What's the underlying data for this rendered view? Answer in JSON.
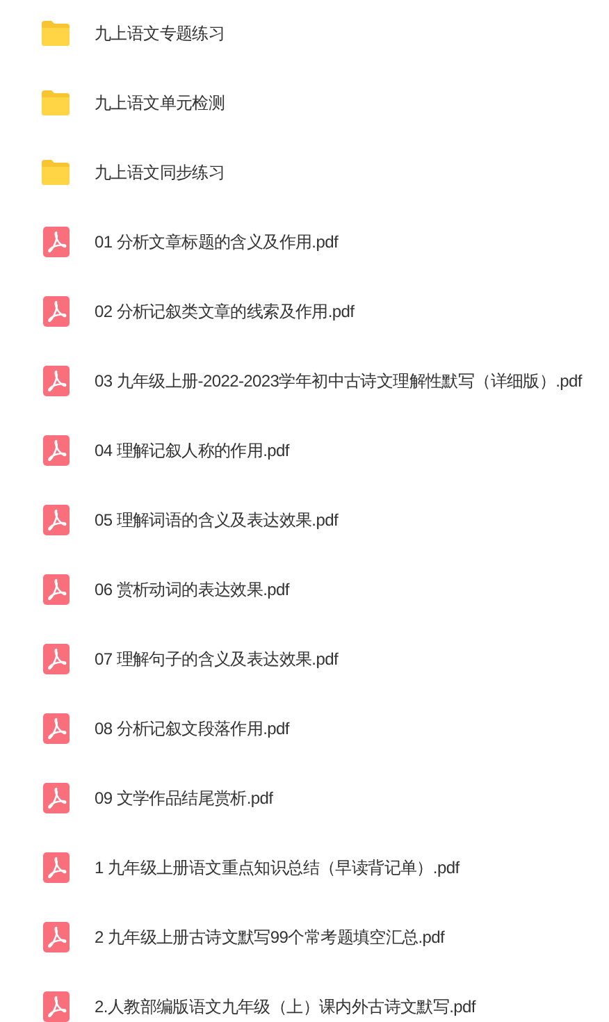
{
  "files": [
    {
      "kind": "folder",
      "name": "九上语文专题练习"
    },
    {
      "kind": "folder",
      "name": "九上语文单元检测"
    },
    {
      "kind": "folder",
      "name": "九上语文同步练习"
    },
    {
      "kind": "pdf",
      "name": "01 分析文章标题的含义及作用.pdf"
    },
    {
      "kind": "pdf",
      "name": "02 分析记叙类文章的线索及作用.pdf"
    },
    {
      "kind": "pdf",
      "name": "03 九年级上册-2022-2023学年初中古诗文理解性默写（详细版）.pdf"
    },
    {
      "kind": "pdf",
      "name": "04 理解记叙人称的作用.pdf"
    },
    {
      "kind": "pdf",
      "name": "05 理解词语的含义及表达效果.pdf"
    },
    {
      "kind": "pdf",
      "name": "06 赏析动词的表达效果.pdf"
    },
    {
      "kind": "pdf",
      "name": "07 理解句子的含义及表达效果.pdf"
    },
    {
      "kind": "pdf",
      "name": "08 分析记叙文段落作用.pdf"
    },
    {
      "kind": "pdf",
      "name": "09 文学作品结尾赏析.pdf"
    },
    {
      "kind": "pdf",
      "name": "1 九年级上册语文重点知识总结（早读背记单）.pdf"
    },
    {
      "kind": "pdf",
      "name": "2 九年级上册古诗文默写99个常考题填空汇总.pdf"
    },
    {
      "kind": "pdf",
      "name": "2.人教部编版语文九年级（上）课内外古诗文默写.pdf"
    }
  ]
}
